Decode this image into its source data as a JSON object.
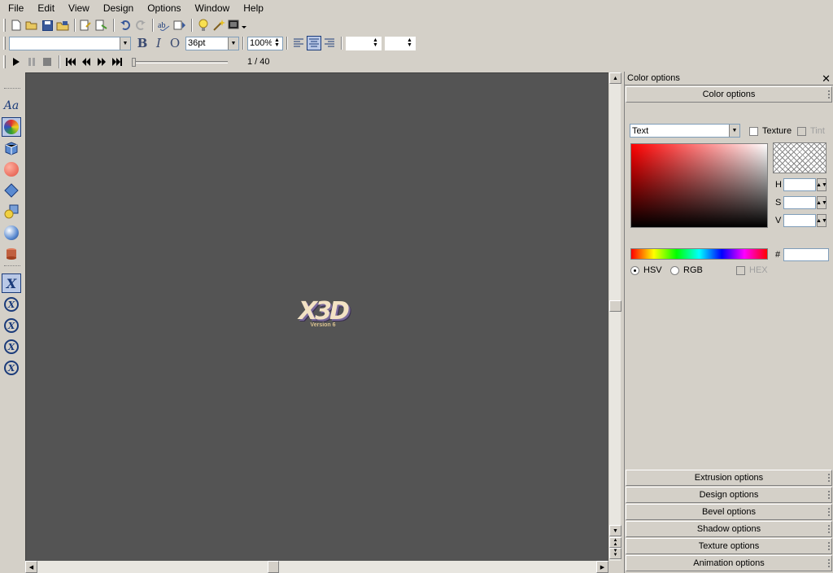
{
  "menu": [
    "File",
    "Edit",
    "View",
    "Design",
    "Options",
    "Window",
    "Help"
  ],
  "format_bar": {
    "font_name": "",
    "font_size": "36pt",
    "zoom": "100%",
    "bold": "B",
    "italic": "I",
    "outline": "O"
  },
  "playback": {
    "frame_counter": "1 / 40"
  },
  "viewport": {
    "logo_text": "X3D",
    "logo_sub": "Version 6"
  },
  "panel": {
    "title": "Color options",
    "close": "✕",
    "color_section": "Color options",
    "target_select": "Text",
    "texture_label": "Texture",
    "tint_label": "Tint",
    "h_label": "H",
    "s_label": "S",
    "v_label": "V",
    "hex_label": "#",
    "hsv_label": "HSV",
    "rgb_label": "RGB",
    "hex_check_label": "HEX",
    "sections": [
      "Extrusion options",
      "Design options",
      "Bevel options",
      "Shadow options",
      "Texture options",
      "Animation options"
    ]
  },
  "colors": {
    "viewport_bg": "#545454",
    "ui_bg": "#d4d0c8",
    "accent": "#1b3b7a"
  }
}
